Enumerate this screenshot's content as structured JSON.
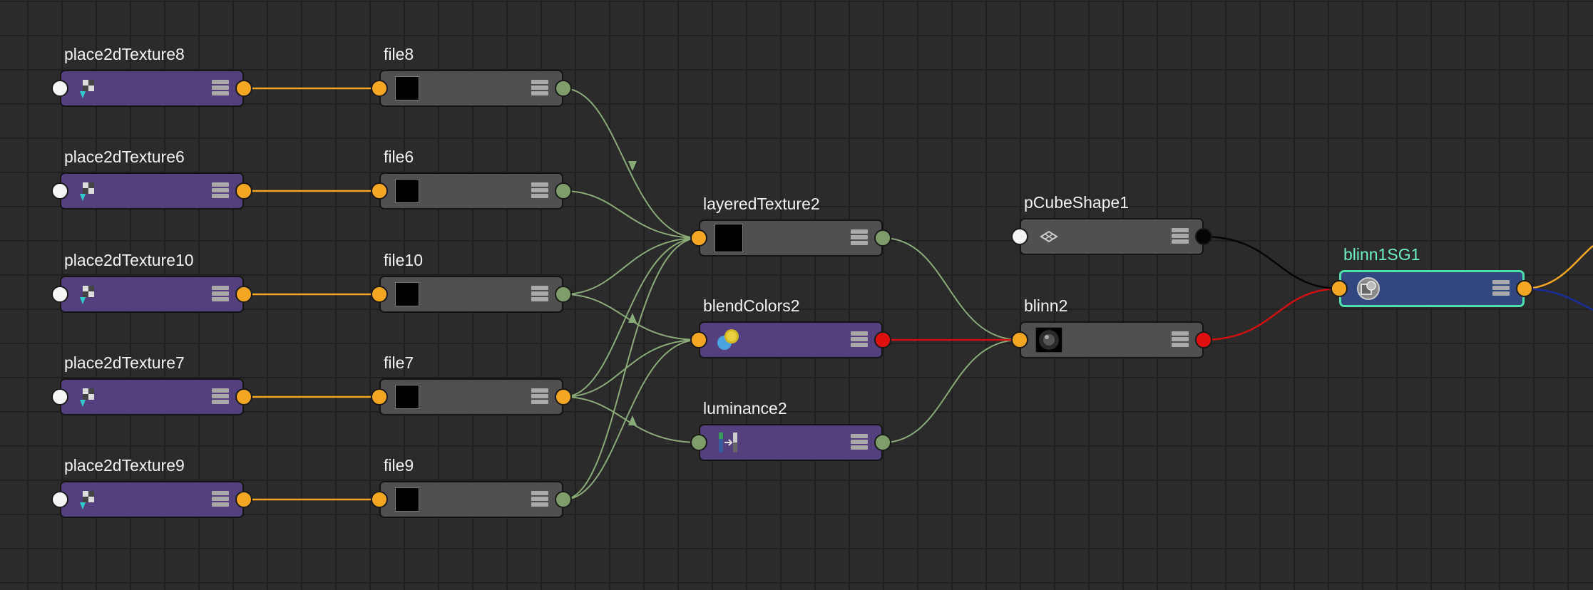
{
  "nodes": [
    {
      "label": "place2dTexture8",
      "icon": "place2d-texture-icon"
    },
    {
      "label": "place2dTexture6",
      "icon": "place2d-texture-icon"
    },
    {
      "label": "place2dTexture10",
      "icon": "place2d-texture-icon"
    },
    {
      "label": "place2dTexture7",
      "icon": "place2d-texture-icon"
    },
    {
      "label": "place2dTexture9",
      "icon": "place2d-texture-icon"
    },
    {
      "label": "file8",
      "icon": "file-thumbnail-icon"
    },
    {
      "label": "file6",
      "icon": "file-thumbnail-icon"
    },
    {
      "label": "file10",
      "icon": "file-thumbnail-icon"
    },
    {
      "label": "file7",
      "icon": "file-thumbnail-icon"
    },
    {
      "label": "file9",
      "icon": "file-thumbnail-icon"
    },
    {
      "label": "layeredTexture2",
      "icon": "layered-texture-thumbnail-icon"
    },
    {
      "label": "blendColors2",
      "icon": "blend-colors-icon"
    },
    {
      "label": "luminance2",
      "icon": "luminance-icon"
    },
    {
      "label": "pCubeShape1",
      "icon": "mesh-shape-icon"
    },
    {
      "label": "blinn2",
      "icon": "blinn-sphere-icon"
    },
    {
      "label": "blinn1SG1",
      "icon": "shading-group-icon"
    }
  ],
  "colors": {
    "background": "#2b2b2b",
    "grid": "#1f1f1f",
    "node_purple": "#55407f",
    "node_gray": "#505050",
    "node_blue": "#32477f",
    "selection": "#4ee0ac",
    "wire_orange": "#f5a623",
    "wire_green": "#8aab78",
    "wire_red": "#d01010",
    "wire_black": "#050505",
    "wire_navy": "#1a2d9a"
  }
}
